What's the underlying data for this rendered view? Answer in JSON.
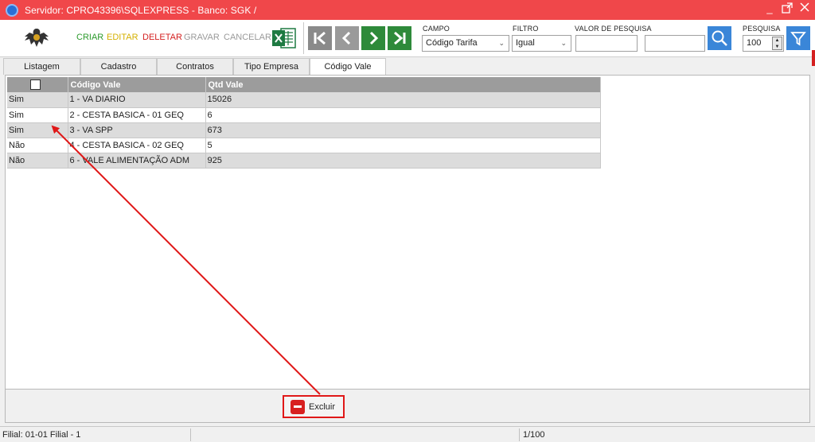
{
  "window": {
    "title": "Servidor: CPRO43396\\SQLEXPRESS - Banco: SGK /"
  },
  "toolbar": {
    "criar": "CRIAR",
    "editar": "EDITAR",
    "deletar": "DELETAR",
    "gravar": "GRAVAR",
    "cancelar": "CANCELAR"
  },
  "filters": {
    "campo_label": "CAMPO",
    "campo_value": "Código Tarifa",
    "filtro_label": "FILTRO",
    "filtro_value": "Igual",
    "valor_label": "VALOR DE PESQUISA",
    "valor_value": "",
    "pesquisa_label": "PESQUISA",
    "pesquisa_value": "100"
  },
  "tabs": [
    {
      "label": "Listagem"
    },
    {
      "label": "Cadastro"
    },
    {
      "label": "Contratos"
    },
    {
      "label": "Tipo Empresa"
    },
    {
      "label": "Código Vale"
    }
  ],
  "grid": {
    "columns": [
      "",
      "Código Vale",
      "Qtd Vale"
    ],
    "rows": [
      {
        "flag": "Sim",
        "codigo": "1 - VA DIARIO",
        "qtd": "15026"
      },
      {
        "flag": "Sim",
        "codigo": "2 - CESTA BASICA - 01 GEQ",
        "qtd": "6"
      },
      {
        "flag": "Sim",
        "codigo": "3 - VA SPP",
        "qtd": "673"
      },
      {
        "flag": "Não",
        "codigo": "4 - CESTA BASICA - 02 GEQ",
        "qtd": "5"
      },
      {
        "flag": "Não",
        "codigo": "6 - VALE ALIMENTAÇÃO ADM",
        "qtd": "925"
      }
    ]
  },
  "actions": {
    "excluir": "Excluir"
  },
  "status": {
    "filial": "Filial: 01-01 Filial - 1",
    "pages": "1/100"
  },
  "colors": {
    "titlebar": "#f0474a",
    "annotation": "#e01818",
    "nav_green": "#2e8a3a",
    "search_blue": "#3a86d8"
  }
}
